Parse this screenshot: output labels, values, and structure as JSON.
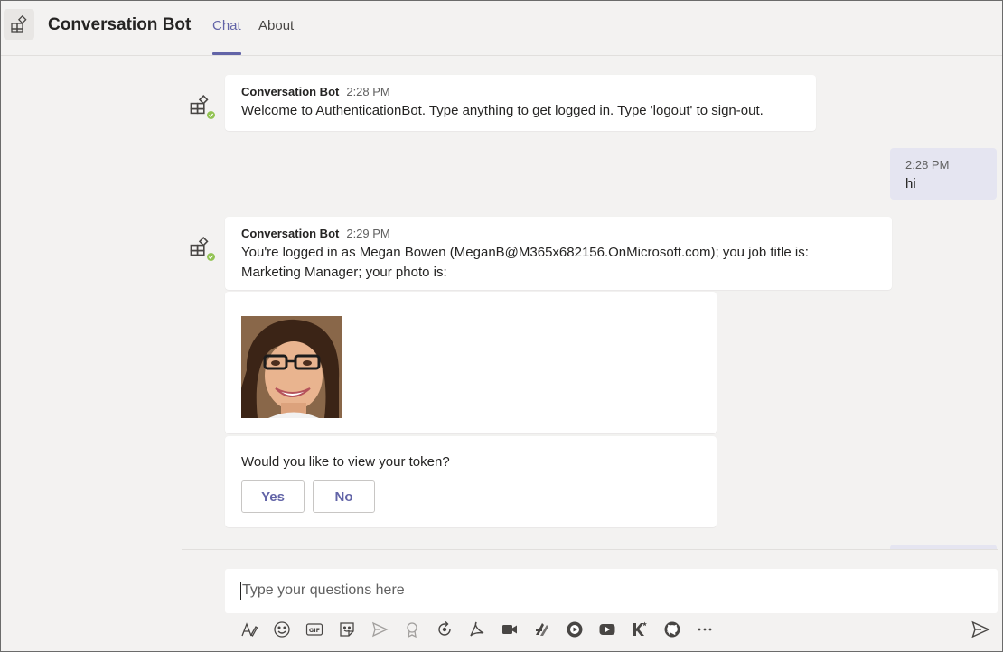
{
  "header": {
    "app_title": "Conversation Bot",
    "tabs": [
      {
        "label": "Chat",
        "active": true
      },
      {
        "label": "About",
        "active": false
      }
    ]
  },
  "messages": {
    "bot1": {
      "sender": "Conversation Bot",
      "time": "2:28 PM",
      "text": "Welcome to AuthenticationBot. Type anything to get logged in. Type 'logout' to sign-out."
    },
    "me1": {
      "time": "2:28 PM",
      "text": "hi"
    },
    "bot2": {
      "sender": "Conversation Bot",
      "time": "2:29 PM",
      "text_line1": "You're logged in as Megan Bowen (MeganB@M365x682156.OnMicrosoft.com); you job title is:",
      "text_line2": "Marketing Manager; your photo is:"
    },
    "card": {
      "question": "Would you like to view your token?",
      "yes_label": "Yes",
      "no_label": "No"
    }
  },
  "compose": {
    "placeholder": "Type your questions here"
  },
  "toolbar": {
    "icons": [
      "format-icon",
      "emoji-icon",
      "gif-icon",
      "sticker-icon",
      "meet-now-icon",
      "praise-icon",
      "loop-icon",
      "pdf-icon",
      "video-icon",
      "planner-icon",
      "stream-icon",
      "youtube-icon",
      "kudos-icon",
      "github-icon",
      "more-options-icon"
    ]
  },
  "colors": {
    "accent": "#6264a7",
    "background": "#f3f2f1",
    "my_bubble": "#e5e5f1",
    "presence": "#92c353"
  }
}
